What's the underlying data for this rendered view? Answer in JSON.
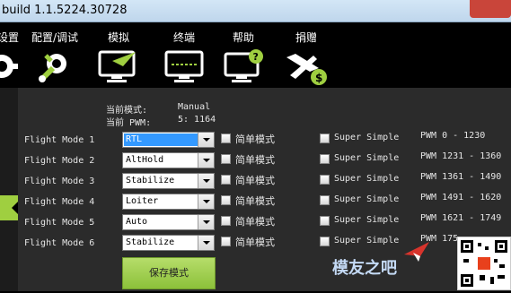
{
  "window": {
    "title": "build 1.1.5224.30728"
  },
  "toolbar": {
    "items": [
      {
        "label": "设置",
        "icon": "gear-icon"
      },
      {
        "label": "配置/调试",
        "icon": "wrench-icon"
      },
      {
        "label": "模拟",
        "icon": "monitor-plane-icon"
      },
      {
        "label": "终端",
        "icon": "terminal-icon"
      },
      {
        "label": "帮助",
        "icon": "help-monitor-icon"
      },
      {
        "label": "捐赠",
        "icon": "donate-plane-icon"
      }
    ]
  },
  "status": {
    "current_mode_label": "当前模式:",
    "current_mode_value": "Manual",
    "current_pwm_label": "当前 PWM:",
    "current_pwm_value": "5: 1164"
  },
  "modes": [
    {
      "label": "Flight Mode 1",
      "value": "RTL",
      "simple_label": "简单模式",
      "super_simple_label": "Super Simple",
      "pwm": "PWM 0 - 1230"
    },
    {
      "label": "Flight Mode 2",
      "value": "AltHold",
      "simple_label": "简单模式",
      "super_simple_label": "Super Simple",
      "pwm": "PWM 1231 - 1360"
    },
    {
      "label": "Flight Mode 3",
      "value": "Stabilize",
      "simple_label": "简单模式",
      "super_simple_label": "Super Simple",
      "pwm": "PWM 1361 - 1490"
    },
    {
      "label": "Flight Mode 4",
      "value": "Loiter",
      "simple_label": "简单模式",
      "super_simple_label": "Super Simple",
      "pwm": "PWM 1491 - 1620"
    },
    {
      "label": "Flight Mode 5",
      "value": "Auto",
      "simple_label": "简单模式",
      "super_simple_label": "Super Simple",
      "pwm": "PWM 1621 - 1749"
    },
    {
      "label": "Flight Mode 6",
      "value": "Stabilize",
      "simple_label": "简单模式",
      "super_simple_label": "Super Simple",
      "pwm": "PWM 175"
    }
  ],
  "save_button": {
    "label": "保存模式"
  },
  "watermark": {
    "text": "模友之吧"
  },
  "colors": {
    "accent_green": "#9fcf40",
    "selection_blue": "#3399ff",
    "panel_bg": "#2b2b2b"
  }
}
